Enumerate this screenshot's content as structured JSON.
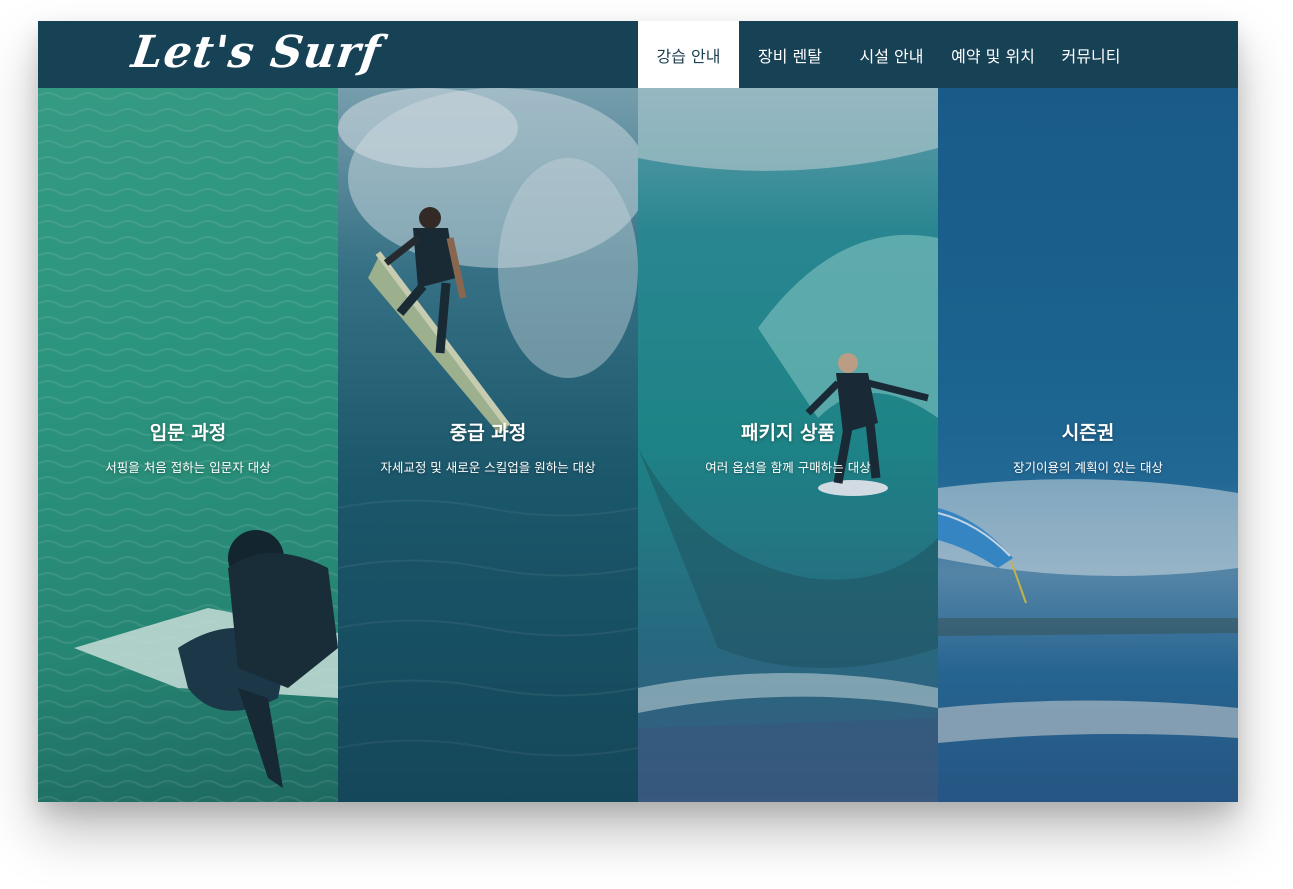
{
  "header": {
    "logo_text": "Let's Surf",
    "nav": [
      {
        "label": "강습 안내",
        "active": true
      },
      {
        "label": "장비 렌탈",
        "active": false
      },
      {
        "label": "시설 안내",
        "active": false
      },
      {
        "label": "예약 및 위치",
        "active": false
      },
      {
        "label": "커뮤니티",
        "active": false
      }
    ]
  },
  "courses": [
    {
      "title": "입문 과정",
      "description": "서핑을 처음 접하는 입문자 대상"
    },
    {
      "title": "중급 과정",
      "description": "자세교정 및 새로운 스킬업을 원하는 대상"
    },
    {
      "title": "패키지 상품",
      "description": "여러 옵션을 함께 구매하는 대상"
    },
    {
      "title": "시즌권",
      "description": "장기이용의 계획이 있는 대상"
    }
  ],
  "colors": {
    "header_bg": "#174256",
    "active_nav_bg": "#ffffff",
    "active_nav_text": "#1d3f4f",
    "text": "#ffffff"
  }
}
